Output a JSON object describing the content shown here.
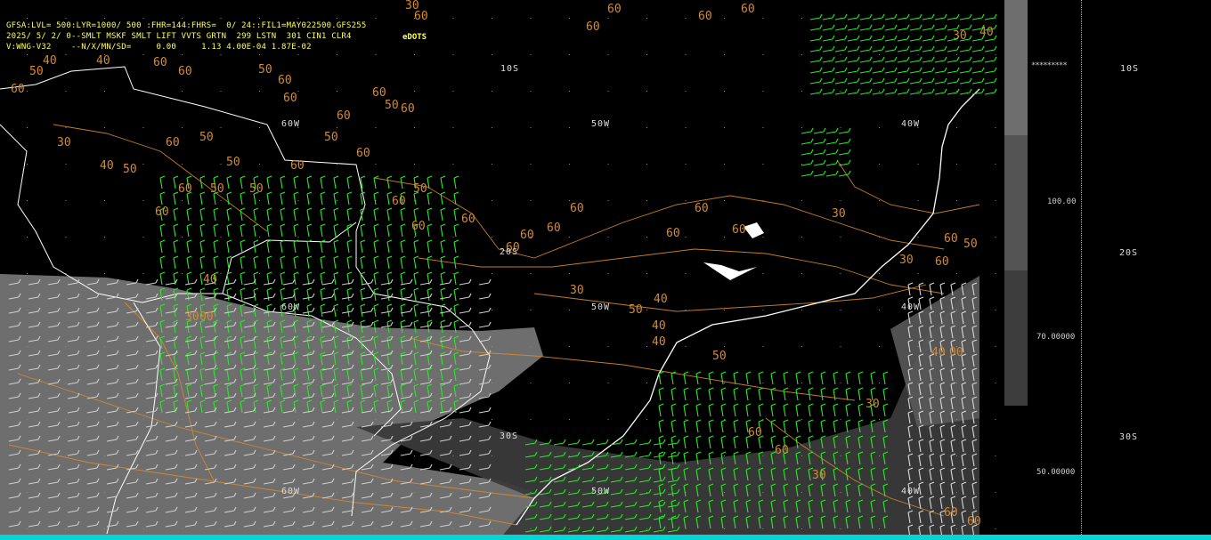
{
  "header": {
    "line1": "GFSA:LVL= 500:LYR=1000/ 500 :FHR=144:FHRS=  0/ 24::FIL1=MAY022500.GFS255",
    "line2": "2025/ 5/ 2/ 0--SMLT MSKF SMLT LIFT VVTS GRTN  299 LSTN  301 CIN1 CLR4",
    "line3": "V:WNG-V32    --N/X/MN/SD=     0.00     1.13 4.00E-04 1.87E-02",
    "dots_label": "eDOTS"
  },
  "grid_labels": {
    "lat_10s": "10S",
    "lat_20s": "20S",
    "lat_30s": "30S",
    "lon_60w": "60W",
    "lon_50w": "50W",
    "lon_40w": "40W"
  },
  "colorbar": {
    "labels": [
      "100.00",
      "70.00000",
      "50.00000"
    ],
    "segments": [
      "#6e6e6e",
      "#545454",
      "#3c3c3c"
    ]
  },
  "right_panel": {
    "stars": "*********",
    "lat_labels": [
      "10S",
      "20S",
      "30S"
    ]
  },
  "contour_labels": [
    "30",
    "40",
    "50",
    "60"
  ],
  "colors": {
    "header_text": "#ffff55",
    "contour": "#d98a2a",
    "wind_barb": "#22ee22",
    "coastline": "#ffffff",
    "shading_light": "#7a7a7a",
    "shading_dark": "#3a3a3a"
  }
}
